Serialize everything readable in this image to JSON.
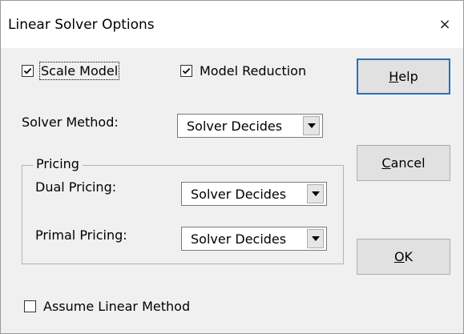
{
  "dialog": {
    "title": "Linear Solver Options",
    "close_glyph": "×"
  },
  "options": {
    "scale_model": {
      "label": "Scale Model",
      "checked": true
    },
    "model_reduction": {
      "label": "Model Reduction",
      "checked": true
    },
    "assume_linear_method": {
      "label": "Assume Linear Method",
      "checked": false
    }
  },
  "solver_method": {
    "label": "Solver Method:",
    "value": "Solver Decides"
  },
  "pricing": {
    "legend": "Pricing",
    "dual": {
      "label": "Dual Pricing:",
      "value": "Solver Decides"
    },
    "primal": {
      "label": "Primal Pricing:",
      "value": "Solver Decides"
    }
  },
  "buttons": {
    "help": {
      "mnemonic": "H",
      "rest": "elp"
    },
    "cancel": {
      "mnemonic": "C",
      "rest": "ancel"
    },
    "ok": {
      "mnemonic": "O",
      "rest": "K"
    }
  },
  "colors": {
    "default_button_border": "#1e73c8",
    "dialog_bg": "#f0f0f0"
  }
}
